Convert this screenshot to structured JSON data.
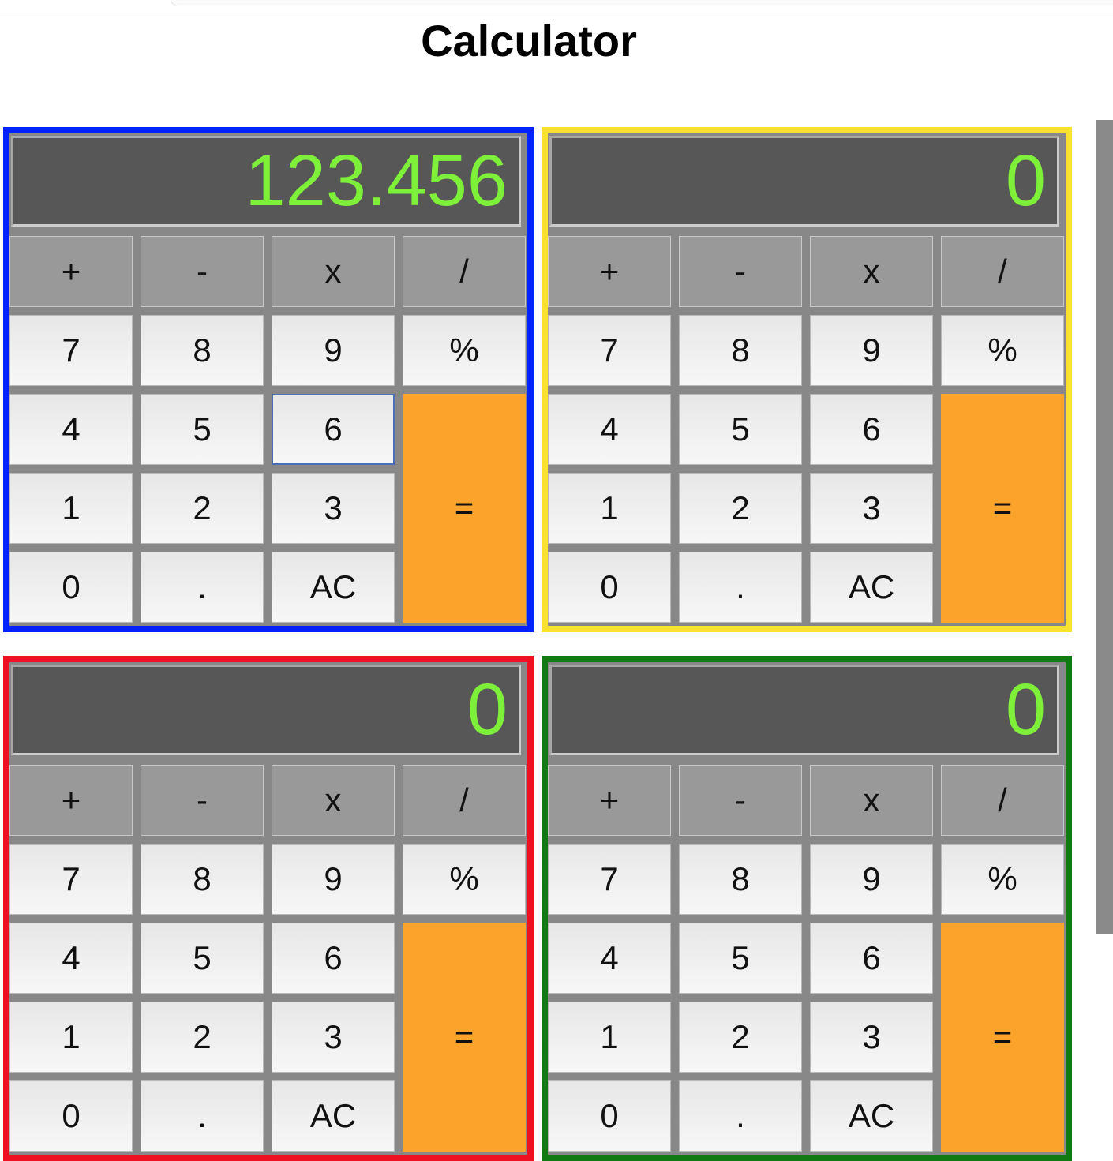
{
  "page": {
    "title": "Calculator"
  },
  "calculators": [
    {
      "display": "123.456",
      "border_color": "#0022ff"
    },
    {
      "display": "0",
      "border_color": "#f9e22f"
    },
    {
      "display": "0",
      "border_color": "#ee1122"
    },
    {
      "display": "0",
      "border_color": "#127a12"
    }
  ],
  "keys": {
    "plus": "+",
    "minus": "-",
    "times": "x",
    "divide": "/",
    "seven": "7",
    "eight": "8",
    "nine": "9",
    "percent": "%",
    "four": "4",
    "five": "5",
    "six": "6",
    "equals": "=",
    "one": "1",
    "two": "2",
    "three": "3",
    "zero": "0",
    "dot": ".",
    "clear": "AC"
  },
  "colors": {
    "display_text": "#7ef03a",
    "display_background": "#575757",
    "equals_key": "#fba32a"
  }
}
